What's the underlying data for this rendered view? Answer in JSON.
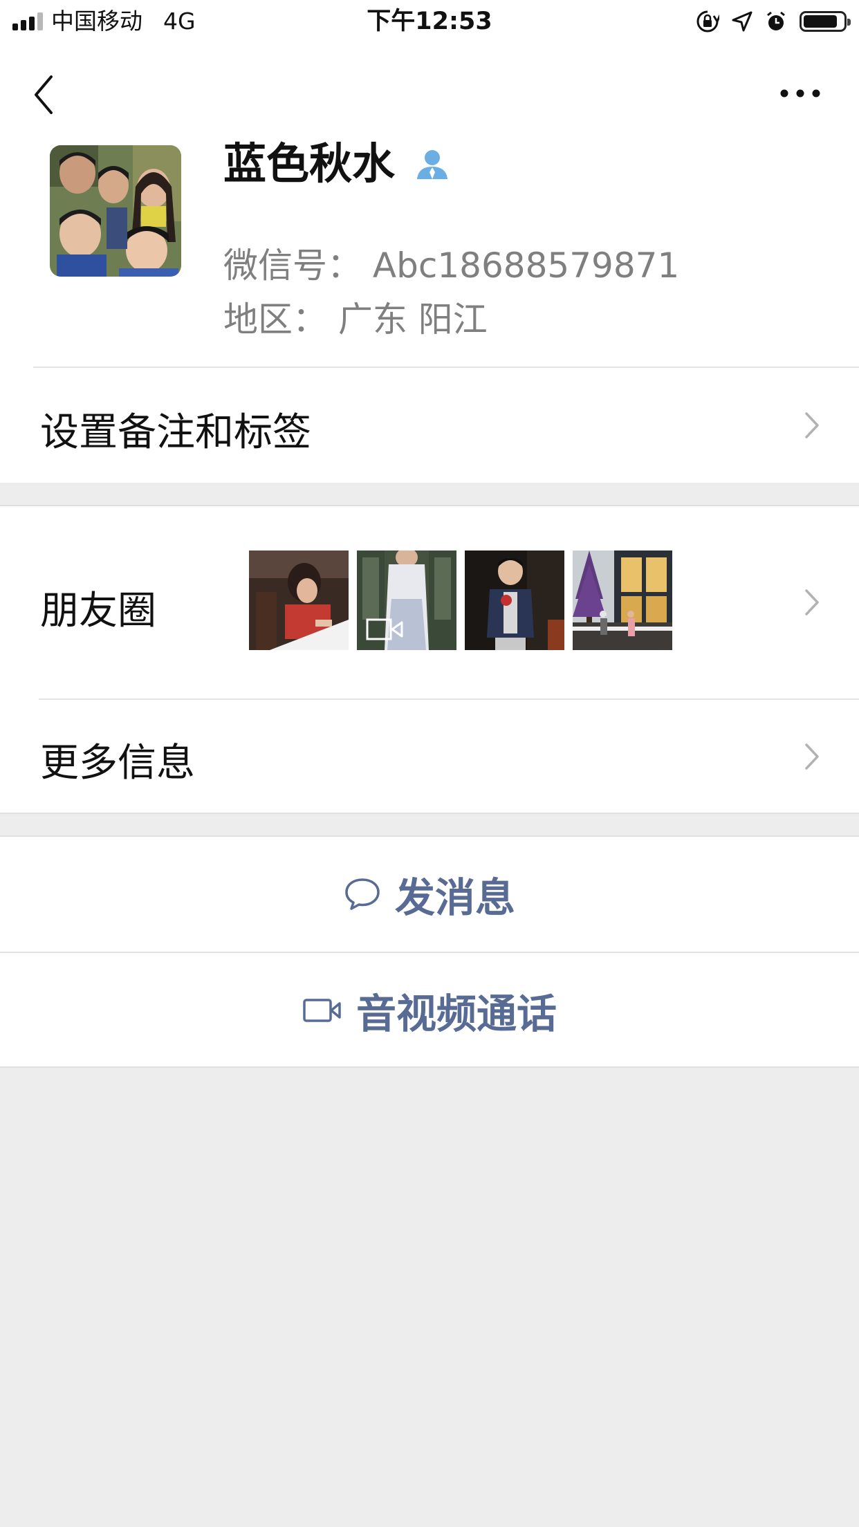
{
  "status_bar": {
    "carrier": "中国移动",
    "network": "4G",
    "time": "下午12:53",
    "icons": [
      "signal-icon",
      "orientation-lock-icon",
      "location-icon",
      "alarm-icon",
      "battery-icon"
    ],
    "battery_level": 0.85
  },
  "profile": {
    "name": "蓝色秋水",
    "wechat_id": "微信号：  Abc18688579871",
    "region": "地区：  广东 阳江"
  },
  "rows": {
    "remark_label": "设置备注和标签",
    "moments_label": "朋友圈",
    "more_info_label": "更多信息"
  },
  "actions": {
    "message_label": "发消息",
    "call_label": "音视频通话"
  },
  "colors": {
    "link_blue": "#576b95",
    "secondary_text": "#7f7f7f",
    "background": "#ededed"
  }
}
